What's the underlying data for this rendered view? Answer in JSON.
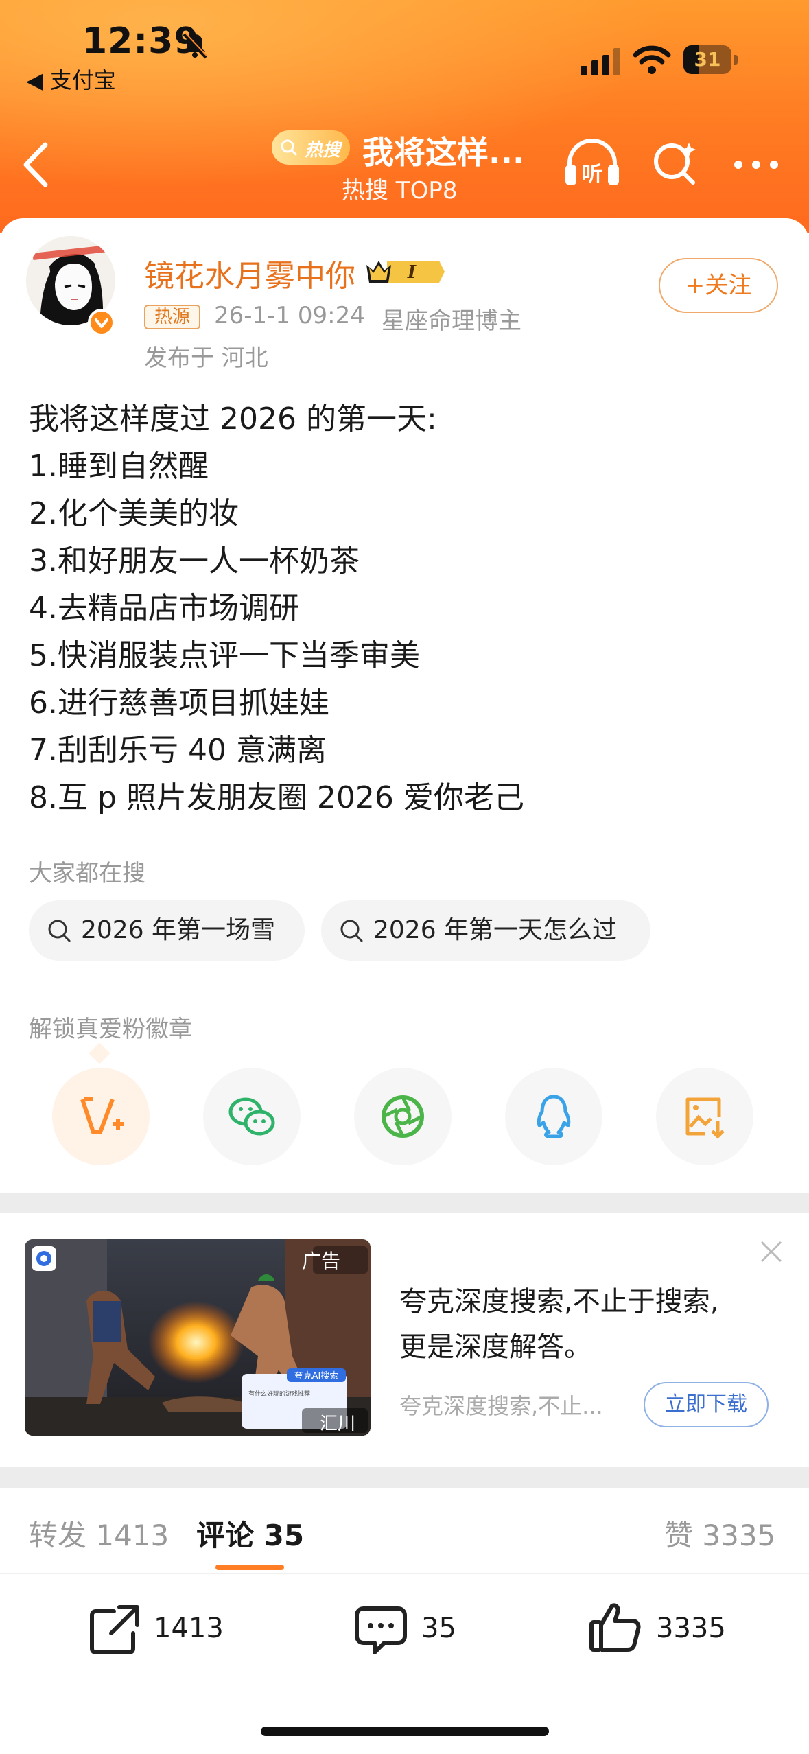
{
  "status_bar": {
    "time": "12:39",
    "back_to_app": "◀ 支付宝",
    "battery": "31"
  },
  "nav": {
    "hot_badge": "热搜",
    "title": "我将这样...",
    "subtitle": "热搜 TOP8",
    "listen_label": "听"
  },
  "post": {
    "username": "镜花水月雾中你",
    "vip_level": "I",
    "source_tag": "热源",
    "date": "26-1-1 09:24",
    "author_tag": "星座命理博主",
    "location": "发布于 河北",
    "follow_label": "+关注",
    "lines": [
      "我将这样度过 2026 的第一天:",
      "1.睡到自然醒",
      "2.化个美美的妆",
      "3.和好朋友一人一杯奶茶",
      "4.去精品店市场调研",
      "5.快消服装点评一下当季审美",
      "6.进行慈善项目抓娃娃",
      "7.刮刮乐亏 40 意满离",
      "8.互 p 照片发朋友圈 2026 爱你老己"
    ]
  },
  "searching": {
    "label": "大家都在搜",
    "chips": [
      "2026 年第一场雪",
      "2026 年第一天怎么过"
    ]
  },
  "badge_section": {
    "label": "解锁真爱粉徽章"
  },
  "share_icons": [
    "weibo-v-plus-icon",
    "wechat-icon",
    "moments-icon",
    "qq-icon",
    "save-image-icon"
  ],
  "ad": {
    "tag": "广告",
    "brand": "汇川",
    "title_line1": "夸克深度搜索,不止于搜索,",
    "title_line2": "更是深度解答。",
    "description": "夸克深度搜索,不止...",
    "cta": "立即下载",
    "image_badge": "夸克AI搜索",
    "image_query": "有什么好玩的游戏推荐"
  },
  "tabs": {
    "repost_label": "转发",
    "repost_count": "1413",
    "comment_label": "评论",
    "comment_count": "35",
    "like_label": "赞",
    "like_count": "3335"
  },
  "bottom_bar": {
    "repost": "1413",
    "comment": "35",
    "like": "3335"
  },
  "colors": {
    "accent": "#ff7d24",
    "username": "#e8711c",
    "header_gradient_top": "#ff9a2e",
    "header_gradient_bottom": "#ff6a1e"
  }
}
